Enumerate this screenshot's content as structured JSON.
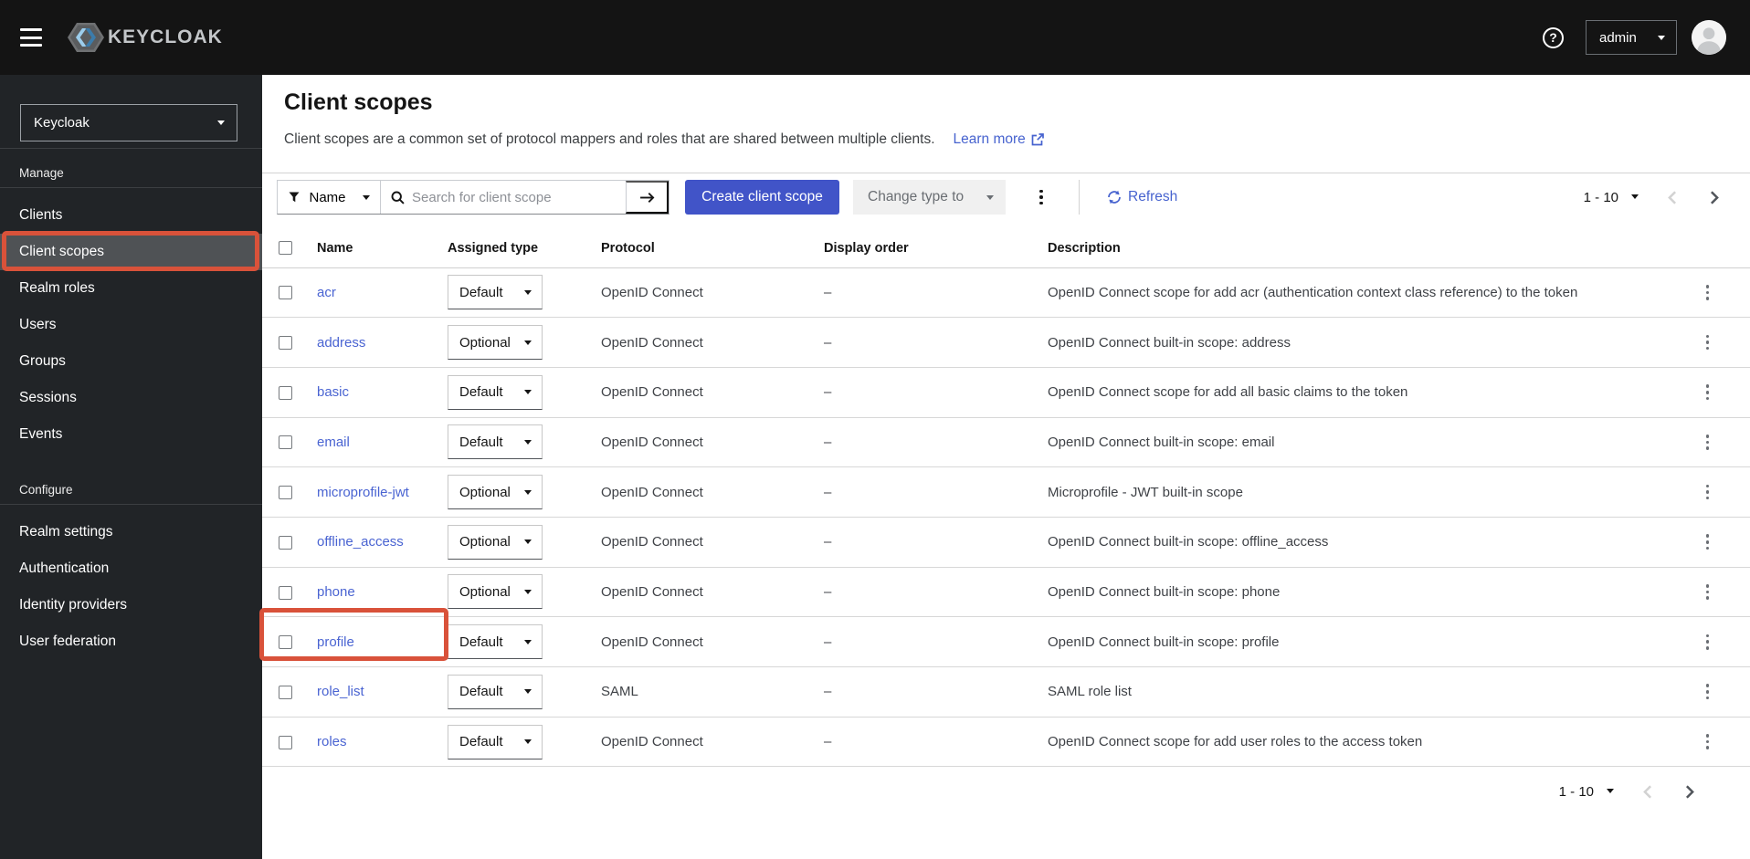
{
  "masthead": {
    "brand": "KEYCLOAK",
    "user": "admin",
    "help": "?"
  },
  "sidebar": {
    "realm": "Keycloak",
    "sections": [
      {
        "label": "Manage",
        "items": [
          {
            "label": "Clients"
          },
          {
            "label": "Client scopes",
            "selected": true
          },
          {
            "label": "Realm roles"
          },
          {
            "label": "Users"
          },
          {
            "label": "Groups"
          },
          {
            "label": "Sessions"
          },
          {
            "label": "Events"
          }
        ]
      },
      {
        "label": "Configure",
        "items": [
          {
            "label": "Realm settings"
          },
          {
            "label": "Authentication"
          },
          {
            "label": "Identity providers"
          },
          {
            "label": "User federation"
          }
        ]
      }
    ]
  },
  "page": {
    "title": "Client scopes",
    "description": "Client scopes are a common set of protocol mappers and roles that are shared between multiple clients.",
    "learn_more": "Learn more"
  },
  "toolbar": {
    "filter_label": "Name",
    "search_placeholder": "Search for client scope",
    "create_button": "Create client scope",
    "change_type_label": "Change type to",
    "refresh_label": "Refresh",
    "pagination": "1 - 10"
  },
  "table": {
    "headers": [
      "Name",
      "Assigned type",
      "Protocol",
      "Display order",
      "Description"
    ],
    "rows": [
      {
        "name": "acr",
        "type": "Default",
        "protocol": "OpenID Connect",
        "display_order": "–",
        "description": "OpenID Connect scope for add acr (authentication context class reference) to the token"
      },
      {
        "name": "address",
        "type": "Optional",
        "protocol": "OpenID Connect",
        "display_order": "–",
        "description": "OpenID Connect built-in scope: address"
      },
      {
        "name": "basic",
        "type": "Default",
        "protocol": "OpenID Connect",
        "display_order": "–",
        "description": "OpenID Connect scope for add all basic claims to the token"
      },
      {
        "name": "email",
        "type": "Default",
        "protocol": "OpenID Connect",
        "display_order": "–",
        "description": "OpenID Connect built-in scope: email"
      },
      {
        "name": "microprofile-jwt",
        "type": "Optional",
        "protocol": "OpenID Connect",
        "display_order": "–",
        "description": "Microprofile - JWT built-in scope"
      },
      {
        "name": "offline_access",
        "type": "Optional",
        "protocol": "OpenID Connect",
        "display_order": "–",
        "description": "OpenID Connect built-in scope: offline_access"
      },
      {
        "name": "phone",
        "type": "Optional",
        "protocol": "OpenID Connect",
        "display_order": "–",
        "description": "OpenID Connect built-in scope: phone"
      },
      {
        "name": "profile",
        "type": "Default",
        "protocol": "OpenID Connect",
        "display_order": "–",
        "description": "OpenID Connect built-in scope: profile",
        "annotated": true
      },
      {
        "name": "role_list",
        "type": "Default",
        "protocol": "SAML",
        "display_order": "–",
        "description": "SAML role list"
      },
      {
        "name": "roles",
        "type": "Default",
        "protocol": "OpenID Connect",
        "display_order": "–",
        "description": "OpenID Connect scope for add user roles to the access token"
      }
    ],
    "pagination": "1 - 10"
  },
  "colors": {
    "accent_button": "#4154c8",
    "link": "#4763cf",
    "annotation": "#d9523a",
    "masthead_bg": "#141414",
    "sidebar_bg": "#212427"
  }
}
